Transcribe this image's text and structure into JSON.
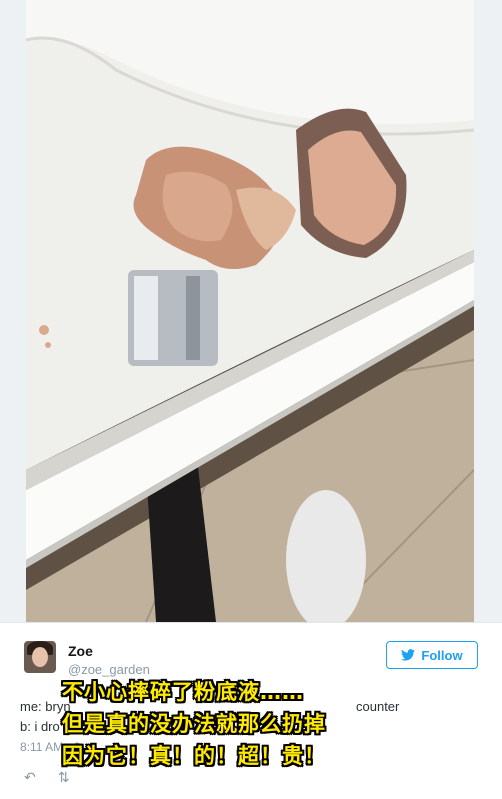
{
  "tweet": {
    "display_name": "Zoe",
    "handle": "@zoe_garden",
    "follow_label": "Follow",
    "line1": "me: bryn",
    "line1_tail": "counter",
    "line2": "b: i dro",
    "timestamp": "8:11 AM - 2",
    "actions": [
      "reply-icon",
      "retweet-icon"
    ]
  },
  "caption": {
    "line1": "不小心摔碎了粉底液……",
    "line2": "但是真的没办法就那么扔掉",
    "line3": "因为它！真！的！超！贵！"
  },
  "colors": {
    "accent": "#1da1f2",
    "caption_text": "#ffea00"
  }
}
